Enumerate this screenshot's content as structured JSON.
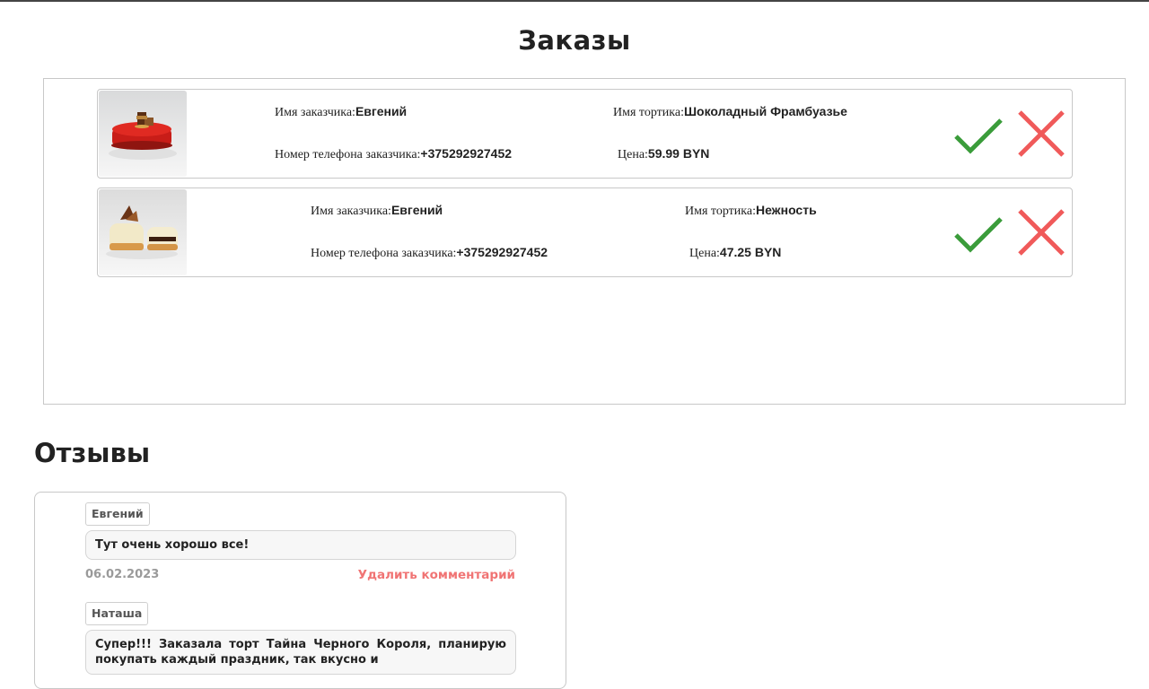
{
  "orders_section": {
    "title": "Заказы",
    "orders": [
      {
        "customer_name_label": "Имя заказчика:",
        "customer_name": "Евгений",
        "cake_name_label": "Имя тортика:",
        "cake_name": "Шоколадный Фрамбуазье",
        "phone_label": "Номер телефона заказчика:",
        "phone": "+375292927452",
        "price_label": "Цена:",
        "price": "59.99 BYN",
        "accept_icon": "checkmark-icon",
        "reject_icon": "cross-icon"
      },
      {
        "customer_name_label": "Имя заказчика:",
        "customer_name": "Евгений",
        "cake_name_label": "Имя тортика:",
        "cake_name": "Нежность",
        "phone_label": "Номер телефона заказчика:",
        "phone": "+375292927452",
        "price_label": "Цена:",
        "price": "47.25 BYN",
        "accept_icon": "checkmark-icon",
        "reject_icon": "cross-icon"
      }
    ]
  },
  "reviews_section": {
    "title": "Отзывы",
    "reviews": [
      {
        "author": "Евгений",
        "text": "Тут очень хорошо все!",
        "date": "06.02.2023",
        "delete_label": "Удалить комментарий"
      },
      {
        "author": "Наташа",
        "text": "Супер!!! Заказала торт Тайна Черного Короля, планирую покупать каждый праздник, так вкусно и"
      }
    ]
  },
  "colors": {
    "accept": "#3a9c3a",
    "reject": "#f05a5a",
    "delete_link": "#f07474",
    "date": "#9a9a9a"
  }
}
